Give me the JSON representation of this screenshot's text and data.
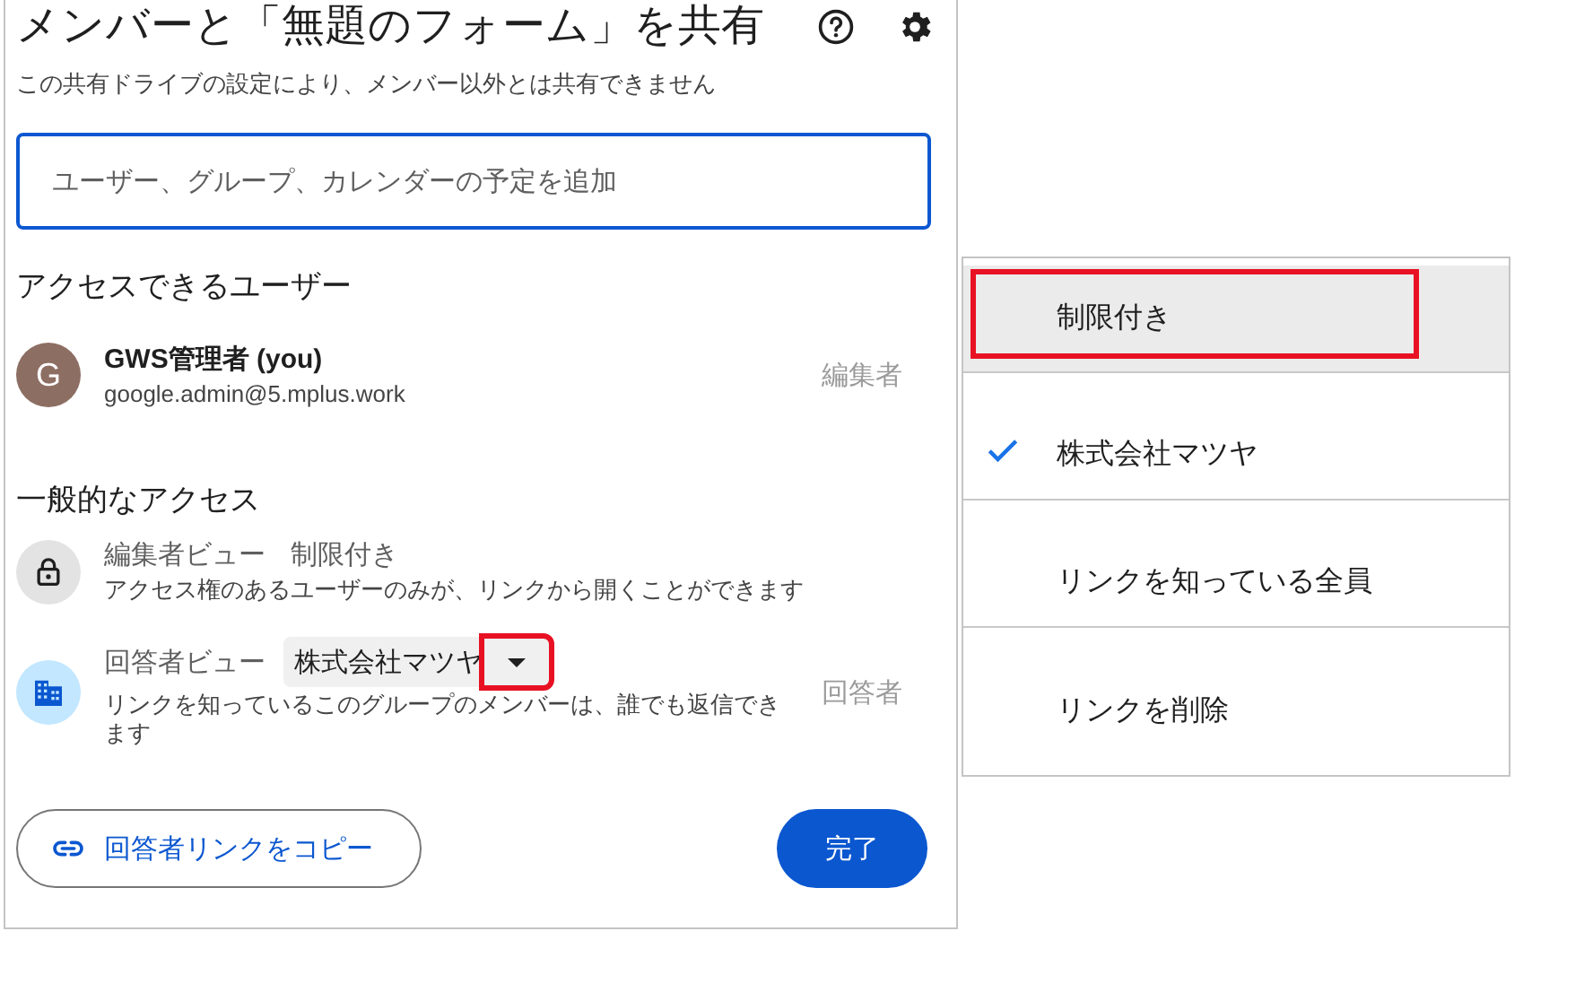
{
  "dialog": {
    "title": "メンバーと「無題のフォーム」を共有",
    "notice": "この共有ドライブの設定により、メンバー以外とは共有できません",
    "add_field": {
      "placeholder": "ユーザー、グループ、カレンダーの予定を追加"
    },
    "people_heading": "アクセスできるユーザー",
    "people": [
      {
        "initial": "G",
        "name": "GWS管理者 (you)",
        "email": "google.admin@5.mplus.work",
        "role": "編集者"
      }
    ],
    "general_heading": "一般的なアクセス",
    "general": [
      {
        "kind": "lock",
        "label": "編集者ビュー",
        "value": "制限付き",
        "description": "アクセス権のあるユーザーのみが、リンクから開くことができます"
      },
      {
        "kind": "group",
        "label": "回答者ビュー",
        "value": "株式会社マツヤ",
        "arrow_highlighted": true,
        "description": "リンクを知っているこのグループのメンバーは、誰でも返信できます",
        "role": "回答者"
      }
    ],
    "copy_button": "回答者リンクをコピー",
    "done_button": "完了"
  },
  "menu": {
    "items": [
      {
        "label": "制限付き",
        "selected": false,
        "hovered": true,
        "highlighted": true
      },
      {
        "label": "株式会社マツヤ",
        "selected": true,
        "hovered": false,
        "highlighted": false
      },
      {
        "label": "リンクを知っている全員",
        "selected": false,
        "hovered": false,
        "highlighted": false
      },
      {
        "label": "リンクを削除",
        "selected": false,
        "hovered": false,
        "highlighted": false
      }
    ]
  }
}
